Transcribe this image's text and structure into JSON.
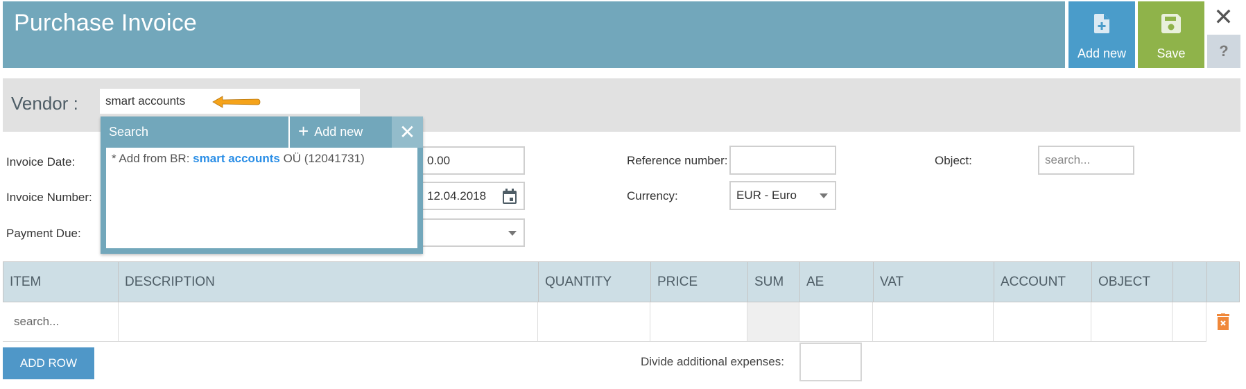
{
  "header": {
    "title": "Purchase Invoice",
    "add_new_label": "Add new",
    "save_label": "Save",
    "close_glyph": "✕",
    "help_glyph": "?"
  },
  "vendor": {
    "label": "Vendor :",
    "value": "smart accounts"
  },
  "dropdown": {
    "search_label": "Search",
    "add_new_label": "Add new",
    "add_icon": "+",
    "close_glyph": "✕",
    "result_prefix": "* Add from BR: ",
    "result_highlight": "smart accounts",
    "result_suffix": " OÜ (12041731)"
  },
  "form": {
    "invoice_date_label": "Invoice Date:",
    "invoice_number_label": "Invoice Number:",
    "payment_due_label": "Payment Due:",
    "amount_value": "0.00",
    "date_value": "12.04.2018",
    "payment_due_value": "",
    "reference_label": "Reference number:",
    "reference_value": "",
    "currency_label": "Currency:",
    "currency_value": "EUR - Euro",
    "object_label": "Object:",
    "object_placeholder": "search..."
  },
  "table": {
    "columns": [
      "ITEM",
      "DESCRIPTION",
      "QUANTITY",
      "PRICE",
      "SUM",
      "AE",
      "VAT",
      "ACCOUNT",
      "OBJECT",
      ""
    ],
    "rows": [
      {
        "item_placeholder": "search..."
      }
    ]
  },
  "footer": {
    "add_row_label": "ADD ROW",
    "divide_label": "Divide additional expenses:",
    "divide_value": ""
  },
  "colors": {
    "header": "#72a7bb",
    "add_new": "#4a9cca",
    "save": "#8fb34a",
    "highlight": "#2a8ee6",
    "delete": "#f0883a",
    "arrow": "#f5a31a"
  }
}
